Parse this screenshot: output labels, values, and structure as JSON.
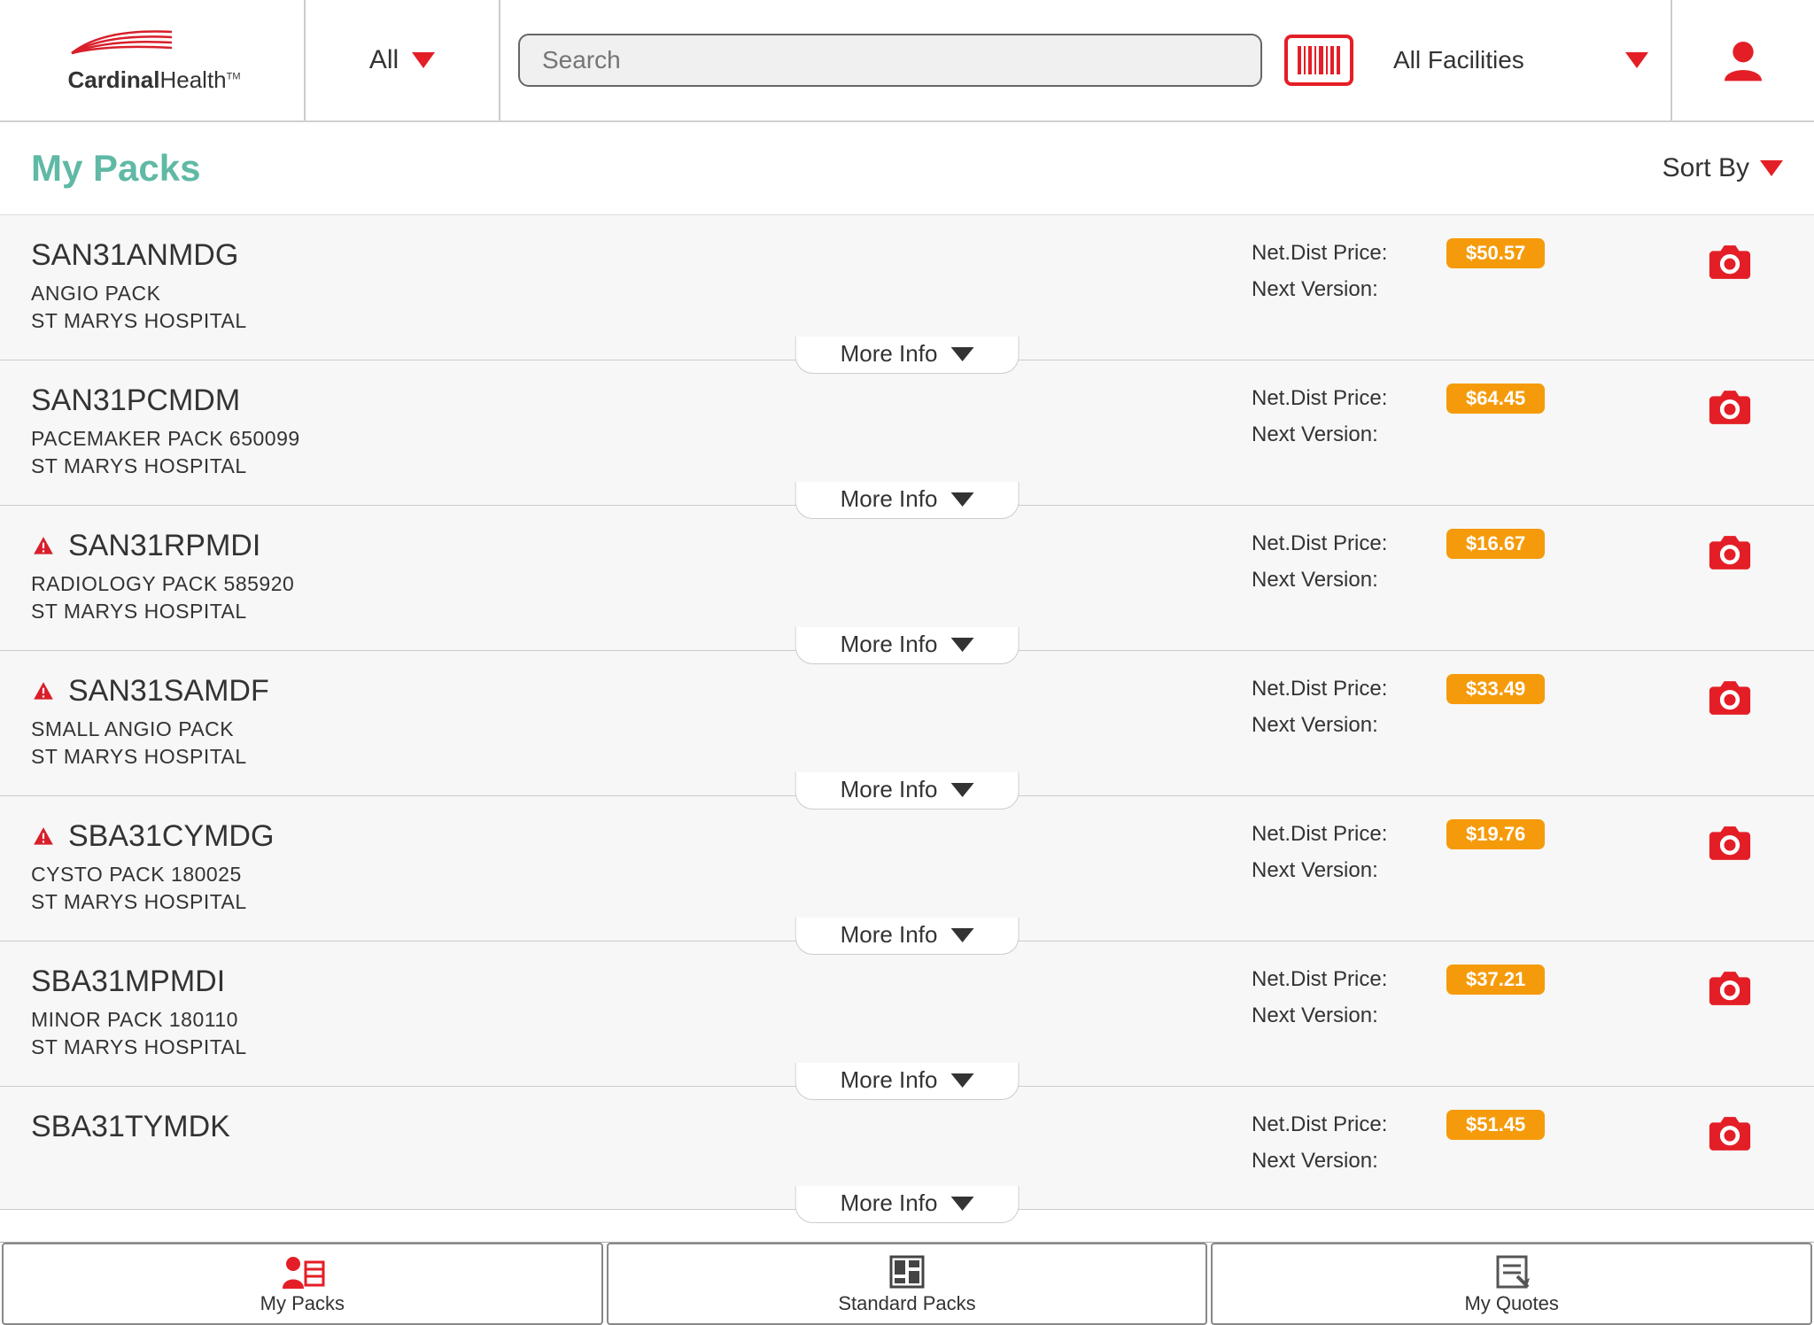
{
  "header": {
    "logo_bold": "Cardinal",
    "logo_normal": "Health",
    "tm": "TM",
    "all_label": "All",
    "search_placeholder": "Search",
    "facilities_label": "All Facilities"
  },
  "page": {
    "title": "My Packs",
    "sort_by": "Sort By"
  },
  "labels": {
    "net_dist_price": "Net.Dist Price:",
    "next_version": "Next Version:",
    "more_info": "More Info"
  },
  "items": [
    {
      "code": "SAN31ANMDG",
      "desc": "ANGIO PACK",
      "hospital": "ST MARYS HOSPITAL",
      "price": "$50.57",
      "alert": false
    },
    {
      "code": "SAN31PCMDM",
      "desc": "PACEMAKER PACK 650099",
      "hospital": "ST MARYS HOSPITAL",
      "price": "$64.45",
      "alert": false
    },
    {
      "code": "SAN31RPMDI",
      "desc": "RADIOLOGY PACK 585920",
      "hospital": "ST MARYS HOSPITAL",
      "price": "$16.67",
      "alert": true
    },
    {
      "code": "SAN31SAMDF",
      "desc": "SMALL ANGIO PACK",
      "hospital": "ST MARYS HOSPITAL",
      "price": "$33.49",
      "alert": true
    },
    {
      "code": "SBA31CYMDG",
      "desc": "CYSTO PACK 180025",
      "hospital": "ST MARYS HOSPITAL",
      "price": "$19.76",
      "alert": true
    },
    {
      "code": "SBA31MPMDI",
      "desc": "MINOR PACK 180110",
      "hospital": "ST MARYS HOSPITAL",
      "price": "$37.21",
      "alert": false
    },
    {
      "code": "SBA31TYMDK",
      "desc": "",
      "hospital": "",
      "price": "$51.45",
      "alert": false
    }
  ],
  "tabs": {
    "my_packs": "My Packs",
    "standard_packs": "Standard Packs",
    "my_quotes": "My Quotes"
  }
}
